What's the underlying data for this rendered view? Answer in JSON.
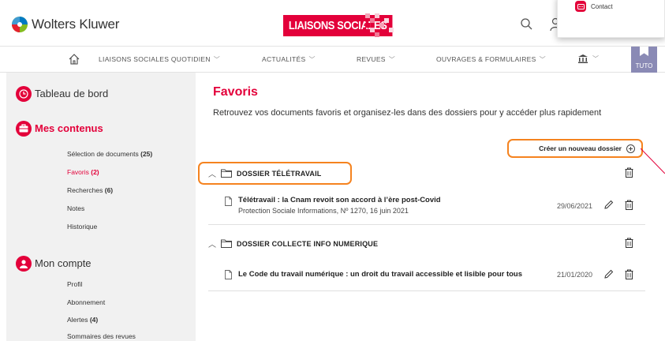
{
  "header": {
    "logo_text": "Wolters Kluwer",
    "brand": "LIAISONS SOCIALES",
    "popup_contact": "Contact"
  },
  "nav": {
    "items": [
      {
        "label": "LIAISONS SOCIALES QUOTIDIEN"
      },
      {
        "label": "ACTUALITÉS"
      },
      {
        "label": "REVUES"
      },
      {
        "label": "OUVRAGES & FORMULAIRES"
      }
    ],
    "tuto": "TUTO"
  },
  "sidebar": {
    "sections": [
      {
        "title": "Tableau de bord"
      },
      {
        "title": "Mes contenus",
        "items": [
          {
            "label": "Sélection de documents",
            "count": "(25)"
          },
          {
            "label": "Favoris",
            "count": "(2)"
          },
          {
            "label": "Recherches",
            "count": "(6)"
          },
          {
            "label": "Notes"
          },
          {
            "label": "Historique"
          }
        ]
      },
      {
        "title": "Mon compte",
        "items": [
          {
            "label": "Profil"
          },
          {
            "label": "Abonnement"
          },
          {
            "label": "Alertes",
            "count": "(4)"
          },
          {
            "label": "Sommaires des revues"
          }
        ]
      }
    ]
  },
  "main": {
    "title": "Favoris",
    "description": "Retrouvez vos documents favoris et organisez-les dans des dossiers pour y accéder plus rapidement",
    "create_folder": "Créer un nouveau dossier",
    "folders": [
      {
        "name": "DOSSIER TÉLÉTRAVAIL",
        "docs": [
          {
            "title": "Télétravail : la Cnam revoit son accord à l’ère post-Covid",
            "source": "Protection Sociale Informations, Nº 1270, 16 juin 2021",
            "date": "29/06/2021"
          }
        ]
      },
      {
        "name": "DOSSIER COLLECTE INFO NUMERIQUE",
        "docs": [
          {
            "title": "Le Code du travail numérique : un droit du travail accessible et lisible pour tous",
            "date": "21/01/2020"
          }
        ]
      }
    ]
  },
  "colors": {
    "accent": "#e3003a",
    "highlight": "#f5831f",
    "tuto": "#8a8ab5"
  }
}
